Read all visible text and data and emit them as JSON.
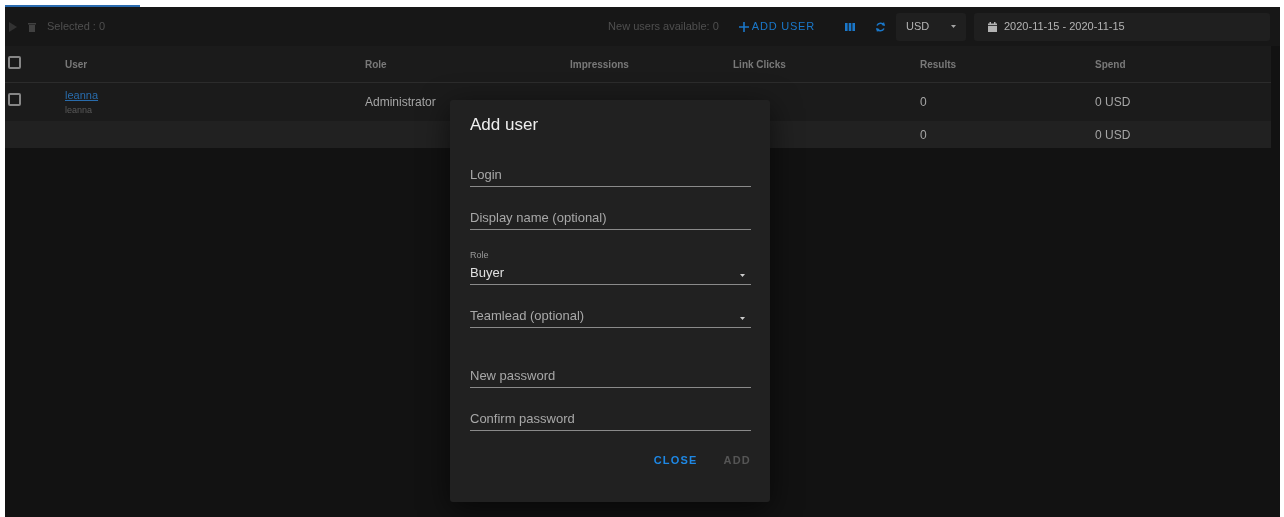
{
  "toolbar": {
    "selected_text": "Selected : 0",
    "new_users_text": "New users available: 0",
    "add_user_label": "ADD USER",
    "currency": "USD",
    "date_range": "2020-11-15 - 2020-11-15"
  },
  "table": {
    "header_checked": false,
    "columns": [
      "User",
      "Role",
      "Impressions",
      "Link Clicks",
      "Results",
      "Spend"
    ],
    "rows": [
      {
        "kind": "user",
        "checked": false,
        "user": "leanna",
        "login": "leanna",
        "role": "Administrator",
        "results": "0",
        "spend": "0 USD"
      },
      {
        "kind": "total",
        "results": "0",
        "spend": "0 USD"
      }
    ]
  },
  "dialog": {
    "title": "Add user",
    "fields": [
      {
        "kind": "input",
        "placeholder": "Login"
      },
      {
        "kind": "input",
        "placeholder": "Display name (optional)"
      },
      {
        "kind": "select",
        "label": "Role",
        "value": "Buyer"
      },
      {
        "kind": "select",
        "placeholder": "Teamlead (optional)"
      },
      {
        "kind": "input",
        "placeholder": "New password"
      },
      {
        "kind": "input",
        "placeholder": "Confirm password"
      }
    ],
    "buttons": [
      {
        "label": "CLOSE",
        "disabled": false
      },
      {
        "label": "ADD",
        "disabled": true
      }
    ]
  }
}
